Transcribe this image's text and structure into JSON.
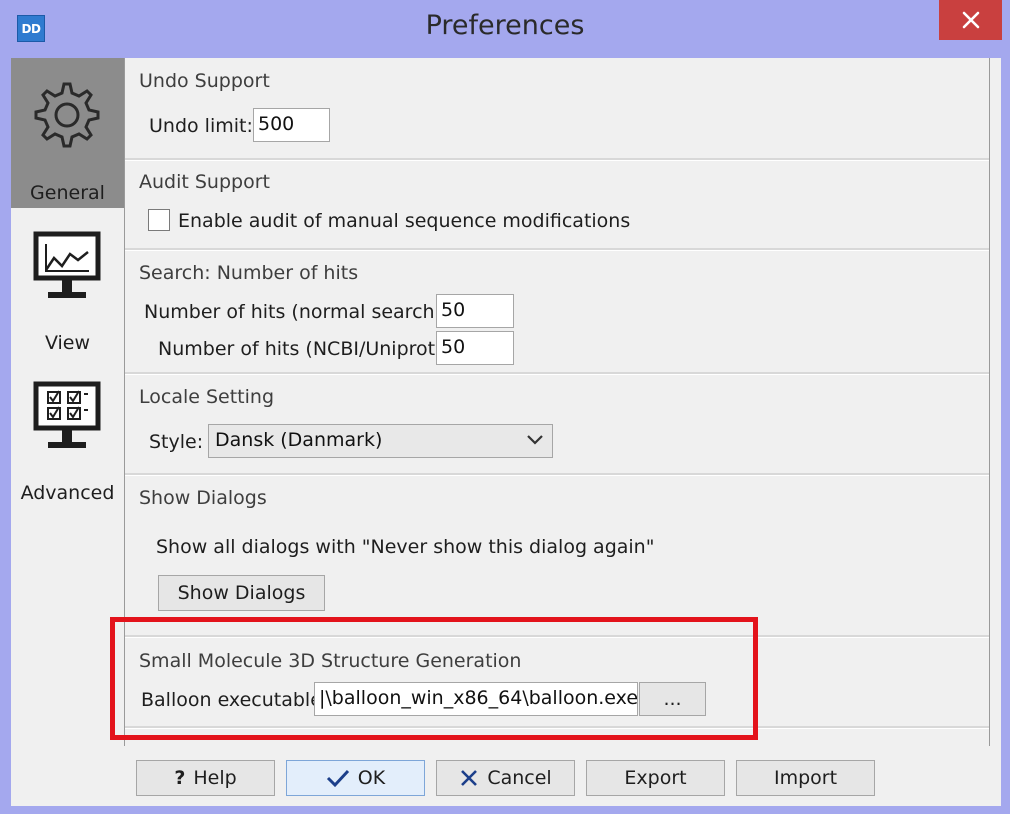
{
  "window": {
    "title": "Preferences",
    "app_icon_text": "DD"
  },
  "sidebar": {
    "items": [
      {
        "label": "General",
        "icon": "gear-icon",
        "active": true
      },
      {
        "label": "View",
        "icon": "monitor-chart-icon",
        "active": false
      },
      {
        "label": "Advanced",
        "icon": "monitor-checklist-icon",
        "active": false
      }
    ]
  },
  "sections": {
    "undo": {
      "title": "Undo Support",
      "label": "Undo limit:",
      "value": "500"
    },
    "audit": {
      "title": "Audit Support",
      "checkbox_label": "Enable audit of manual sequence modifications",
      "checked": false
    },
    "search": {
      "title": "Search: Number of hits",
      "normal_label": "Number of hits (normal search):",
      "normal_value": "50",
      "ncbi_label": "Number of hits (NCBI/Uniprot):",
      "ncbi_value": "50"
    },
    "locale": {
      "title": "Locale Setting",
      "label": "Style:",
      "value": "Dansk (Danmark)"
    },
    "dialogs": {
      "title": "Show Dialogs",
      "description": "Show all dialogs with \"Never show this dialog again\"",
      "button": "Show Dialogs"
    },
    "molecule": {
      "title": "Small Molecule 3D Structure Generation",
      "label": "Balloon executable:",
      "value": "|\\balloon_win_x86_64\\balloon.exe",
      "browse": "..."
    }
  },
  "footer": {
    "help": "Help",
    "ok": "OK",
    "cancel": "Cancel",
    "export": "Export",
    "import": "Import"
  },
  "colors": {
    "title_bar": "#a4a8ee",
    "close_button": "#c9403f",
    "highlight": "#e3131b",
    "active_nav": "#8c8c8c"
  }
}
